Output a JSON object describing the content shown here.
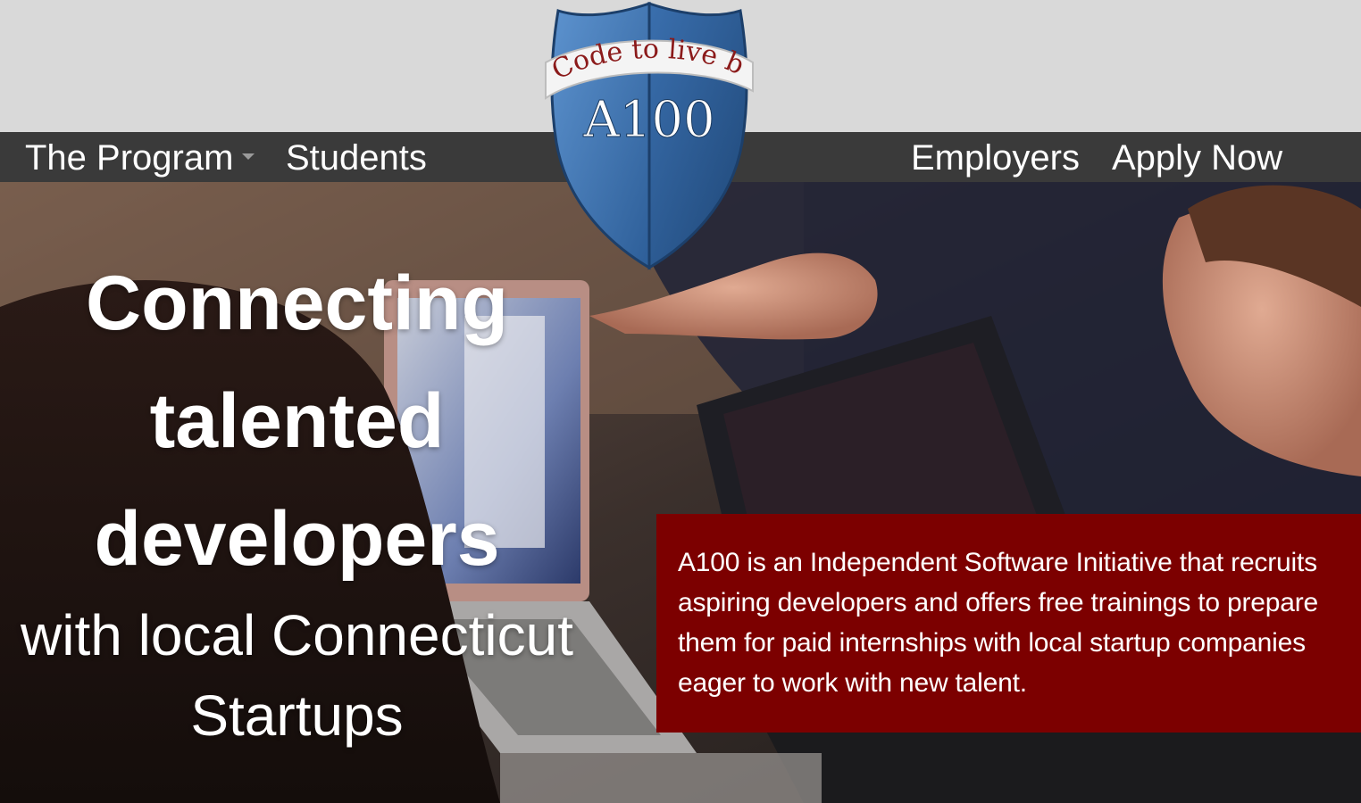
{
  "nav": {
    "program_label": "The Program",
    "students_label": "Students",
    "employers_label": "Employers",
    "apply_label": "Apply Now"
  },
  "logo": {
    "tagline": "Code to live by",
    "mark": "A100"
  },
  "hero": {
    "line1": "Connecting",
    "line2": "talented",
    "line3": "developers",
    "line4": "with local Connecticut",
    "line5": "Startups"
  },
  "info": {
    "text": "A100 is an Independent Software Initiative that recruits aspiring developers and offers free trainings to prepare them for paid internships with local startup companies eager to work with new talent."
  },
  "colors": {
    "nav_bg": "#3a3a3a",
    "top_band": "#d9d9d9",
    "info_bg": "#7c0000",
    "shield_blue": "#2f6aa6",
    "brand_red": "#8b1a1a"
  },
  "icons": {
    "dropdown": "caret-down-icon"
  }
}
